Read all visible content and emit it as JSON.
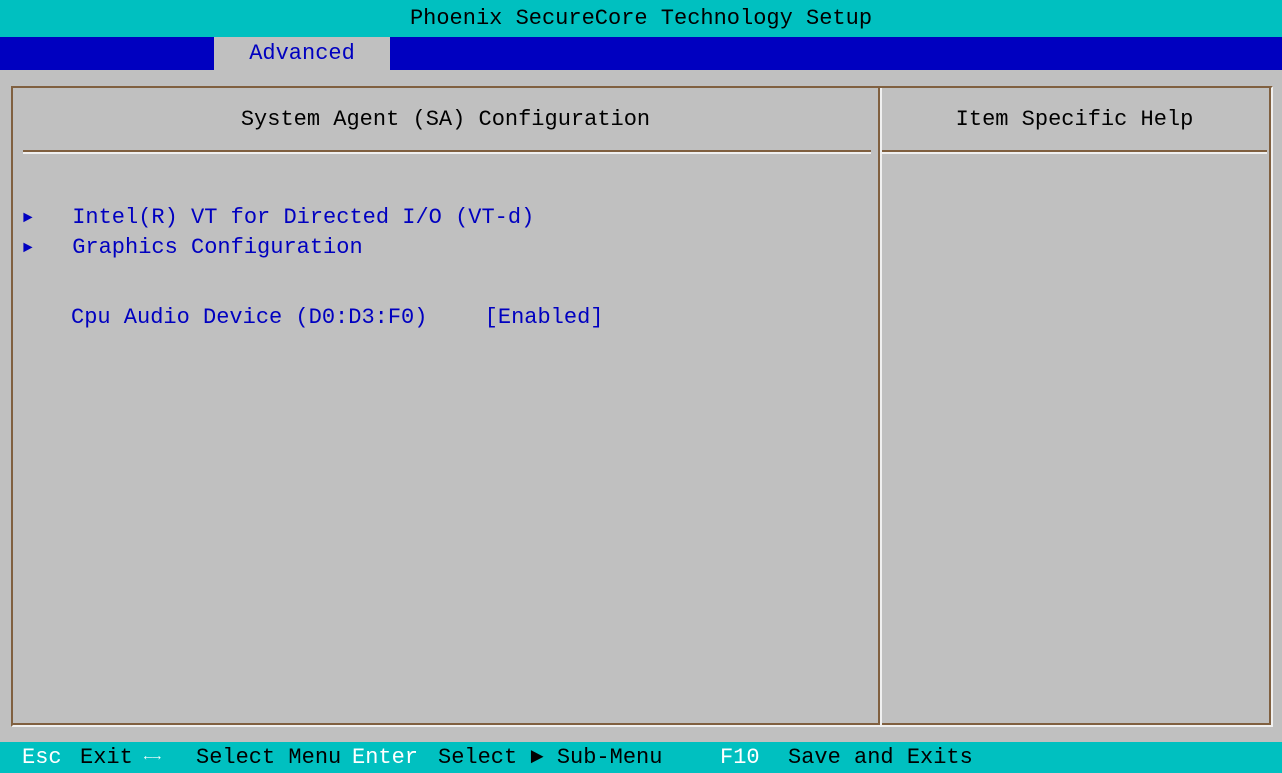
{
  "title": "Phoenix SecureCore Technology Setup",
  "menu": {
    "active_tab": "Advanced"
  },
  "main_pane": {
    "header": "System Agent (SA) Configuration",
    "items": [
      {
        "arrow": "►",
        "label": "Intel(R) VT for Directed I/O (VT-d)",
        "type": "submenu"
      },
      {
        "arrow": "►",
        "label": "Graphics Configuration",
        "type": "submenu"
      },
      {
        "label": "Cpu Audio Device (D0:D3:F0)",
        "value": "[Enabled]",
        "type": "option"
      }
    ]
  },
  "help_pane": {
    "header": "Item Specific Help"
  },
  "status_bar": {
    "esc_key": "Esc",
    "esc_desc": "Exit",
    "arrows_key": "←→",
    "arrows_desc": "Select Menu",
    "enter_key": "Enter",
    "enter_desc": "Select ► Sub-Menu",
    "f10_key": "F10",
    "f10_desc": "Save and Exits"
  },
  "colors": {
    "title_bg": "#00c0c0",
    "menu_bg": "#0000c0",
    "panel_bg": "#c0c0c0",
    "item_text": "#0000c0",
    "key_text": "#ffffff"
  }
}
